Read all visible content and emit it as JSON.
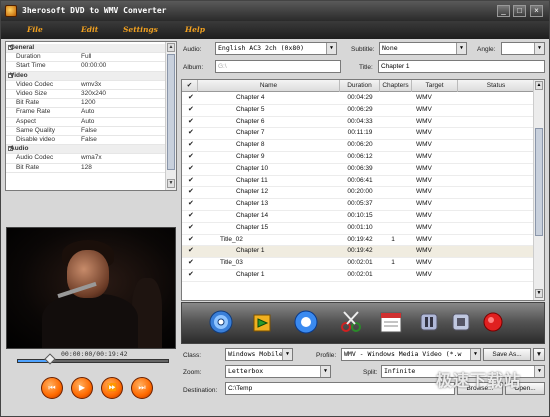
{
  "window": {
    "title": "3herosoft DVD to WMV Converter",
    "minimize": "_",
    "maximize": "□",
    "close": "×"
  },
  "menu": [
    "File",
    "Edit",
    "Settings",
    "Help"
  ],
  "properties": [
    {
      "type": "cat",
      "key": "General"
    },
    {
      "type": "row",
      "key": "Duration",
      "value": "Full"
    },
    {
      "type": "row",
      "key": "Start Time",
      "value": "00:00:00"
    },
    {
      "type": "cat",
      "key": "Video"
    },
    {
      "type": "row",
      "key": "Video Codec",
      "value": "wmv3x"
    },
    {
      "type": "row",
      "key": "Video Size",
      "value": "320x240"
    },
    {
      "type": "row",
      "key": "Bit Rate",
      "value": "1200"
    },
    {
      "type": "row",
      "key": "Frame Rate",
      "value": "Auto"
    },
    {
      "type": "row",
      "key": "Aspect",
      "value": "Auto"
    },
    {
      "type": "row",
      "key": "Same Quality",
      "value": "False"
    },
    {
      "type": "row",
      "key": "Disable video",
      "value": "False"
    },
    {
      "type": "cat",
      "key": "Audio"
    },
    {
      "type": "row",
      "key": "Audio Codec",
      "value": "wma7x"
    },
    {
      "type": "row",
      "key": "Bit Rate",
      "value": "128"
    }
  ],
  "player": {
    "time": "00:00:00/00:19:42",
    "progress": 0.22
  },
  "selectors": {
    "audio_label": "Audio:",
    "audio_value": "English AC3 2ch (0x80)",
    "subtitle_label": "Subtitle:",
    "subtitle_value": "None",
    "angle_label": "Angle:",
    "angle_value": "",
    "album_label": "Album:",
    "album_value": "G:\\",
    "title_label": "Title:",
    "title_value": "Chapter 1"
  },
  "table": {
    "headers": [
      "Name",
      "Duration",
      "Chapters",
      "Target",
      "Status"
    ],
    "rows": [
      {
        "name": "Chapter 4",
        "duration": "00:04:29",
        "chapters": "",
        "target": "WMV",
        "indent": 2
      },
      {
        "name": "Chapter 5",
        "duration": "00:06:29",
        "chapters": "",
        "target": "WMV",
        "indent": 2
      },
      {
        "name": "Chapter 6",
        "duration": "00:04:33",
        "chapters": "",
        "target": "WMV",
        "indent": 2
      },
      {
        "name": "Chapter 7",
        "duration": "00:11:19",
        "chapters": "",
        "target": "WMV",
        "indent": 2
      },
      {
        "name": "Chapter 8",
        "duration": "00:06:20",
        "chapters": "",
        "target": "WMV",
        "indent": 2
      },
      {
        "name": "Chapter 9",
        "duration": "00:06:12",
        "chapters": "",
        "target": "WMV",
        "indent": 2
      },
      {
        "name": "Chapter 10",
        "duration": "00:06:39",
        "chapters": "",
        "target": "WMV",
        "indent": 2
      },
      {
        "name": "Chapter 11",
        "duration": "00:06:41",
        "chapters": "",
        "target": "WMV",
        "indent": 2
      },
      {
        "name": "Chapter 12",
        "duration": "00:20:00",
        "chapters": "",
        "target": "WMV",
        "indent": 2
      },
      {
        "name": "Chapter 13",
        "duration": "00:05:37",
        "chapters": "",
        "target": "WMV",
        "indent": 2
      },
      {
        "name": "Chapter 14",
        "duration": "00:10:15",
        "chapters": "",
        "target": "WMV",
        "indent": 2
      },
      {
        "name": "Chapter 15",
        "duration": "00:01:10",
        "chapters": "",
        "target": "WMV",
        "indent": 2
      },
      {
        "name": "Title_02",
        "duration": "00:19:42",
        "chapters": "1",
        "target": "WMV",
        "indent": 1
      },
      {
        "name": "Chapter 1",
        "duration": "00:19:42",
        "chapters": "",
        "target": "WMV",
        "indent": 2,
        "selected": true
      },
      {
        "name": "Title_03",
        "duration": "00:02:01",
        "chapters": "1",
        "target": "WMV",
        "indent": 1
      },
      {
        "name": "Chapter 1",
        "duration": "00:02:01",
        "chapters": "",
        "target": "WMV",
        "indent": 2
      }
    ]
  },
  "toolbar": [
    "dvd-disc-icon",
    "import-arrow-icon",
    "info-circle-icon",
    "cut-icon",
    "calendar-icon",
    "pause-icon",
    "stop-icon",
    "record-icon"
  ],
  "output": {
    "class_label": "Class:",
    "class_value": "Windows Mobile",
    "profile_label": "Profile:",
    "profile_value": "WMV - Windows Media Video (*.w",
    "save_as": "Save As...",
    "zoom_label": "Zoom:",
    "zoom_value": "Letterbox",
    "split_label": "Split:",
    "split_value": "Infinite",
    "dest_label": "Destination:",
    "dest_value": "C:\\Temp",
    "browse": "Browse...",
    "open": "Open..."
  },
  "watermark": "极速下载站",
  "colors": {
    "accent": "#f0a020",
    "player_button": "#ff6a00",
    "select_row": "#f0ece0"
  }
}
